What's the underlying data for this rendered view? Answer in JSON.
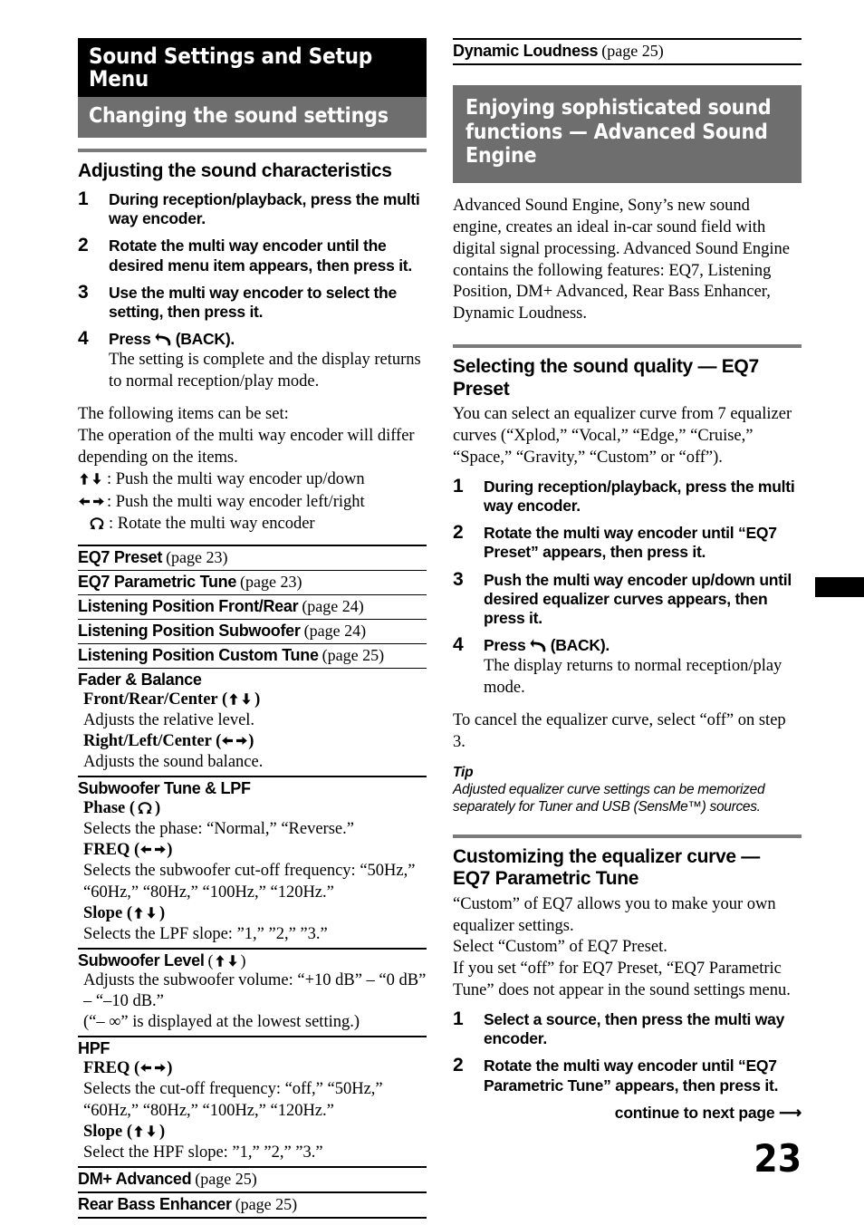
{
  "page": {
    "number": "23",
    "continue_label": "continue to next page",
    "continue_arrow": "⟶"
  },
  "left_column": {
    "chapter_title": "Sound Settings and Setup Menu",
    "section_title": "Changing the sound settings",
    "heading": "Adjusting the sound characteristics",
    "steps": [
      {
        "num": "1",
        "text": "During reception/playback, press the multi way encoder."
      },
      {
        "num": "2",
        "text": "Rotate the multi way encoder until the desired menu item appears, then press it."
      },
      {
        "num": "3",
        "text": "Use the multi way encoder to select the setting, then press it."
      },
      {
        "num": "4",
        "text_before_icon": "Press",
        "icon": "back-icon",
        "text_after_icon": "(BACK).",
        "sub": "The setting is complete and the display returns to normal reception/play mode."
      }
    ],
    "intro_lines": [
      "The following items can be set:",
      "The operation of the multi way encoder will differ depending on the items."
    ],
    "legend": [
      {
        "icon": "up-down-arrows-icon",
        "text": ": Push the multi way encoder up/down"
      },
      {
        "icon": "left-right-arrows-icon",
        "text": ": Push the multi way encoder left/right"
      },
      {
        "icon": "rotate-icon",
        "text": ": Rotate the multi way encoder"
      }
    ],
    "settings": [
      {
        "title": "EQ7 Preset",
        "page": "(page 23)"
      },
      {
        "title": "EQ7 Parametric Tune",
        "page": "(page 23)"
      },
      {
        "title": "Listening Position Front/Rear",
        "page": "(page 24)"
      },
      {
        "title": "Listening Position Subwoofer",
        "page": "(page 24)"
      },
      {
        "title": "Listening Position Custom Tune",
        "page": "(page 25)"
      },
      {
        "title": "Fader & Balance",
        "page": "",
        "subs": [
          {
            "label": "Front/Rear/Center",
            "icon": "up-down-arrows-icon",
            "desc": "Adjusts the relative level."
          },
          {
            "label": "Right/Left/Center",
            "icon": "left-right-arrows-icon",
            "desc": "Adjusts the sound balance."
          }
        ]
      },
      {
        "title": "Subwoofer Tune & LPF",
        "page": "",
        "subs": [
          {
            "label": "Phase",
            "icon": "rotate-icon",
            "desc": "Selects the phase: “Normal,” “Reverse.”"
          },
          {
            "label": "FREQ",
            "icon": "left-right-arrows-icon",
            "desc": "Selects the subwoofer cut-off frequency: “50Hz,” “60Hz,” “80Hz,” “100Hz,” “120Hz.”"
          },
          {
            "label": "Slope",
            "icon": "up-down-arrows-icon",
            "desc": "Selects the LPF slope: ”1,” ”2,” ”3.”"
          }
        ]
      },
      {
        "title": "Subwoofer Level",
        "title_icon": "up-down-arrows-icon",
        "page": "",
        "desc_lines": [
          "Adjusts the subwoofer volume: “+10 dB” – “0 dB” – “–10 dB.”",
          "(“– ∞” is displayed at the lowest setting.)"
        ]
      },
      {
        "title": "HPF",
        "page": "",
        "subs": [
          {
            "label": "FREQ",
            "icon": "left-right-arrows-icon",
            "desc": "Selects the cut-off frequency: “off,” “50Hz,” “60Hz,” “80Hz,” “100Hz,” “120Hz.”"
          },
          {
            "label": "Slope",
            "icon": "up-down-arrows-icon",
            "desc": "Select the HPF slope: ”1,” ”2,” ”3.”"
          }
        ]
      },
      {
        "title": "DM+ Advanced",
        "page": "(page 25)"
      },
      {
        "title": "Rear Bass Enhancer",
        "page": "(page 25)"
      }
    ]
  },
  "right_column": {
    "top_setting": {
      "title": "Dynamic Loudness",
      "page": "(page 25)"
    },
    "gray_banner": "Enjoying sophisticated sound functions — Advanced Sound Engine",
    "intro": "Advanced Sound Engine, Sony’s new sound engine, creates an ideal in-car sound field with digital signal processing. Advanced Sound Engine contains the following features: EQ7, Listening Position, DM+ Advanced, Rear Bass Enhancer, Dynamic Loudness.",
    "section1": {
      "heading": "Selecting the sound quality — EQ7 Preset",
      "intro": "You can select an equalizer curve from 7 equalizer curves (“Xplod,” “Vocal,” “Edge,” “Cruise,” “Space,” “Gravity,” “Custom” or “off”).",
      "steps": [
        {
          "num": "1",
          "text": "During reception/playback, press the multi way encoder."
        },
        {
          "num": "2",
          "text": "Rotate the multi way encoder until “EQ7 Preset” appears, then press it."
        },
        {
          "num": "3",
          "text": "Push the multi way encoder up/down until desired equalizer curves appears, then press it."
        },
        {
          "num": "4",
          "text_before_icon": "Press",
          "icon": "back-icon",
          "text_after_icon": "(BACK).",
          "sub": "The display returns to normal reception/play mode."
        }
      ],
      "note": "To cancel the equalizer curve, select “off” on step 3.",
      "tip_label": "Tip",
      "tip_body": "Adjusted equalizer curve settings can be memorized separately for Tuner and USB (SensMe™) sources."
    },
    "section2": {
      "heading": "Customizing the equalizer curve — EQ7 Parametric Tune",
      "intro": "“Custom” of EQ7 allows you to make your own equalizer settings.\nSelect “Custom” of EQ7 Preset.\nIf you set “off” for EQ7 Preset, “EQ7 Parametric Tune” does not appear in the sound settings menu.",
      "steps": [
        {
          "num": "1",
          "text": "Select a source, then press the multi way encoder."
        },
        {
          "num": "2",
          "text": "Rotate the multi way encoder until “EQ7 Parametric Tune” appears, then press it."
        }
      ]
    }
  }
}
